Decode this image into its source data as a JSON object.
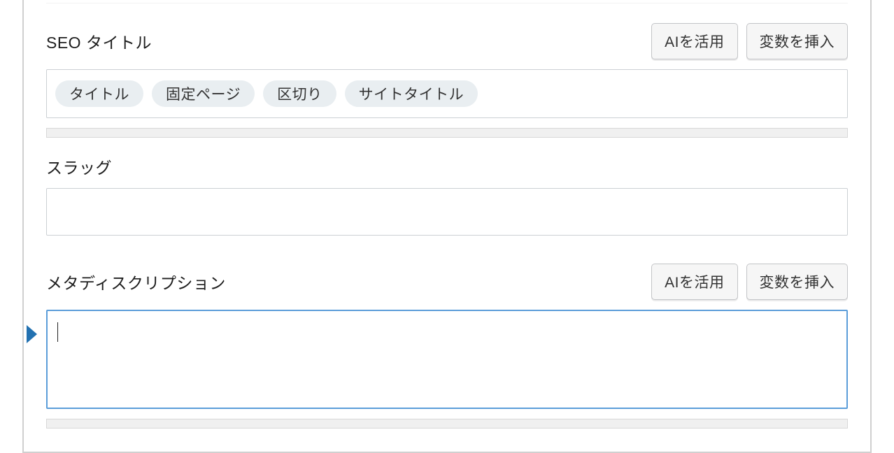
{
  "seo_title": {
    "label": "SEO タイトル",
    "ai_button": "AIを活用",
    "insert_variable_button": "変数を挿入",
    "pills": [
      "タイトル",
      "固定ページ",
      "区切り",
      "サイトタイトル"
    ]
  },
  "slug": {
    "label": "スラッグ",
    "value": ""
  },
  "meta_description": {
    "label": "メタディスクリプション",
    "ai_button": "AIを活用",
    "insert_variable_button": "変数を挿入",
    "value": ""
  }
}
